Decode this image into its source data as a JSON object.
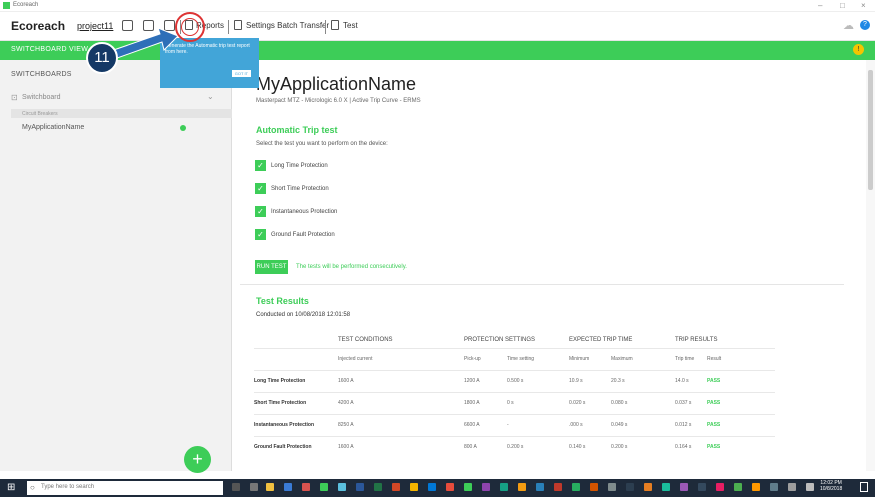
{
  "window": {
    "title": "Ecoreach"
  },
  "menubar": {
    "brand": "Ecoreach",
    "project": "project11",
    "reports": "Reports",
    "settings_batch": "Settings Batch Transfer",
    "test": "Test"
  },
  "sidebar": {
    "view_label": "SWITCHBOARD VIEW",
    "heading": "SWITCHBOARDS",
    "switchboard": "Switchboard",
    "category": "Circuit Breakers",
    "app_item": "MyApplicationName"
  },
  "tooltip": {
    "text": "Generate the Automatic trip test report from here.",
    "got_it": "GOT IT"
  },
  "annotation": {
    "step": "11"
  },
  "main": {
    "title": "MyApplicationName",
    "subtitle": "Masterpact MTZ - Micrologic 6.0 X   |   Active Trip Curve  -  ERMS",
    "auto_trip_title": "Automatic Trip test",
    "auto_trip_desc": "Select the test you want to perform on the device:",
    "options": [
      "Long Time Protection",
      "Short Time Protection",
      "Instantaneous Protection",
      "Ground Fault Protection"
    ],
    "run_test": "RUN TEST",
    "run_note": "The tests will be performed consecutively.",
    "results_title": "Test Results",
    "conducted": "Conducted on 10/08/2018 12:01:58"
  },
  "table": {
    "groups": [
      "TEST CONDITIONS",
      "PROTECTION SETTINGS",
      "EXPECTED TRIP TIME",
      "TRIP RESULTS"
    ],
    "subheads": [
      "Injected current",
      "Pick-up",
      "Time setting",
      "Minimum",
      "Maximum",
      "Trip time",
      "Result"
    ],
    "rows": [
      [
        "Long Time Protection",
        "1600 A",
        "1200 A",
        "0.500 s",
        "10.9 s",
        "20.3 s",
        "14.0 s",
        "PASS"
      ],
      [
        "Short Time Protection",
        "4200 A",
        "1800 A",
        "0 s",
        "0.020 s",
        "0.080 s",
        "0.037 s",
        "PASS"
      ],
      [
        "Instantaneous Protection",
        "8250 A",
        "6600 A",
        "-",
        ".000 s",
        "0.049 s",
        "0.012 s",
        "PASS"
      ],
      [
        "Ground Fault Protection",
        "1600 A",
        "800 A",
        "0.200 s",
        "0.140 s",
        "0.200 s",
        "0.164 s",
        "PASS"
      ]
    ]
  },
  "taskbar": {
    "search_placeholder": "Type here to search",
    "time": "12:02 PM",
    "date": "10/8/2018"
  },
  "colors": {
    "accent": "#3dcd58",
    "tooltip": "#42a5d8",
    "badge": "#153966",
    "highlight": "#dd3333"
  }
}
